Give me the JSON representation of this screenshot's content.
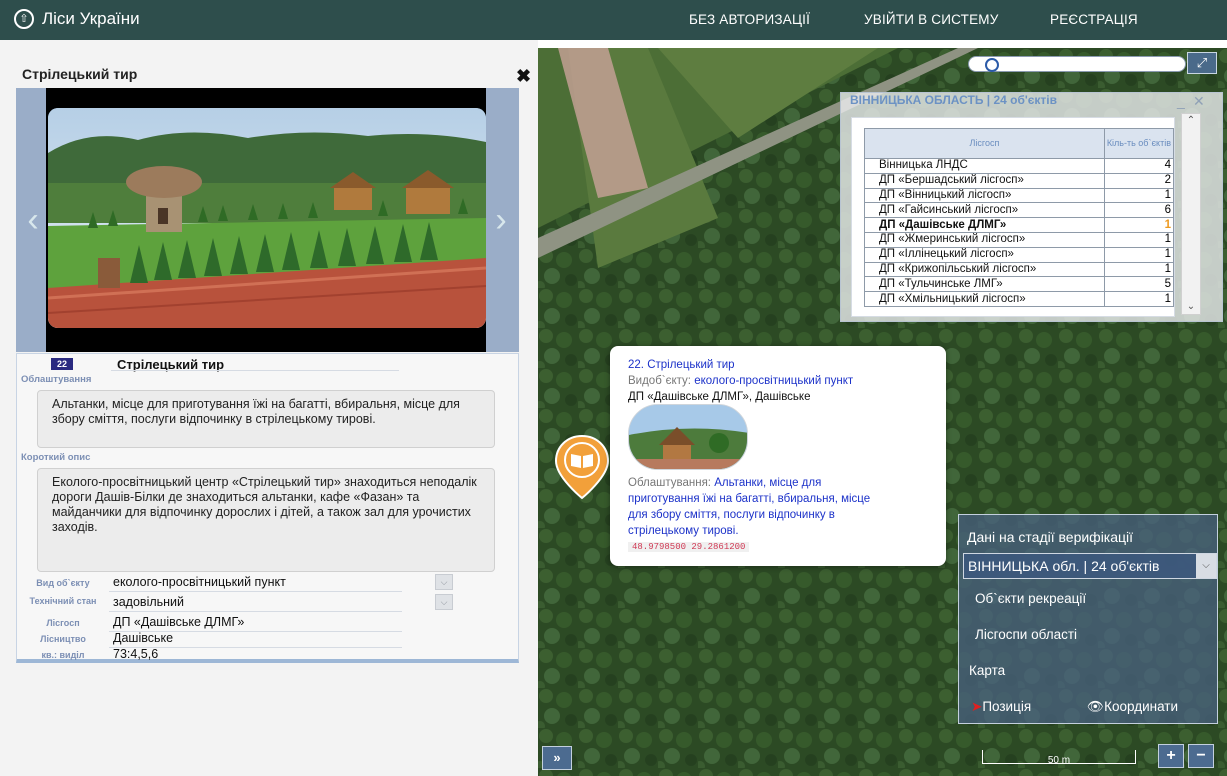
{
  "header": {
    "brand": "Ліси України",
    "nav": [
      "БЕЗ АВТОРИЗАЦІЇ",
      "УВІЙТИ В СИСТЕМУ",
      "РЕЄСТРАЦІЯ"
    ]
  },
  "panel": {
    "title": "Стрілецький тир",
    "close": "✖",
    "item_number": "22",
    "item_title": "Стрілецький тир",
    "facilities_label": "Облаштування",
    "facilities_text": "Альтанки, місце для приготування їжі на багатті, вбиральня, місце для збору сміття, послуги відпочинку в стрілецькому тирові.",
    "description_label": "Короткий опис",
    "description_text": "Еколого-просвітницький центр «Стрілецький тир» знаходиться неподалік дороги Дашів-Білки де знаходиться альтанки, кафе «Фазан» та майданчики для відпочинку дорослих і дітей, а також зал для урочистих заходів.",
    "fields": [
      {
        "label": "Вид об`єкту",
        "value": "еколого-просвітницький пункт"
      },
      {
        "label": "Технічний стан",
        "value": "задовільний"
      },
      {
        "label": "Лісгосп",
        "value": "ДП «Дашівське ДЛМГ»"
      },
      {
        "label": "Лісництво",
        "value": "Дашівське"
      },
      {
        "label": "кв.: виділ",
        "value": "73:4,5,6"
      }
    ]
  },
  "region_window": {
    "title": "ВІННИЦЬКА ОБЛАСТЬ | 24 об'єктів",
    "col_name": "Лісгосп",
    "col_count": "Кіль-ть об`єктів",
    "rows": [
      {
        "name": "Вінницька ЛНДС",
        "count": "4"
      },
      {
        "name": "ДП «Бершадський лісгосп»",
        "count": "2"
      },
      {
        "name": "ДП «Вінницький лісгосп»",
        "count": "1"
      },
      {
        "name": "ДП «Гайсинський лісгосп»",
        "count": "6"
      },
      {
        "name": "ДП «Дашівське ДЛМГ»",
        "count": "1"
      },
      {
        "name": "ДП «Жмеринський лісгосп»",
        "count": "1"
      },
      {
        "name": "ДП «Іллінецький лісгосп»",
        "count": "1"
      },
      {
        "name": "ДП «Крижопільський лісгосп»",
        "count": "1"
      },
      {
        "name": "ДП «Тульчинське ЛМГ»",
        "count": "5"
      },
      {
        "name": "ДП «Хмільницький лісгосп»",
        "count": "1"
      }
    ]
  },
  "popup": {
    "title_prefix": "22.",
    "title": "Стрілецький тир",
    "type_label": "Видоб`єкту:",
    "type_value": "еколого-просвітницький пункт",
    "owner": "ДП «Дашівське ДЛМГ», Дашівське",
    "facilities_label": "Облаштування:",
    "facilities_line1": "Альтанки, місце для",
    "facilities_line2": "приготування їжі на багатті, вбиральня, місце",
    "facilities_line3": "для збору сміття, послуги відпочинку в",
    "facilities_line4": "стрілецькому тирові.",
    "coords": "48.9798500 29.2861200"
  },
  "map_menu": {
    "status": "Дані на стадії верифікації",
    "region_select": "ВІННИЦЬКА обл. | 24 об'єктів",
    "items": [
      "Об`єкти рекреації",
      "Лісгоспи області",
      "Карта"
    ],
    "position": "Позиція",
    "coordinates": "Координати"
  },
  "map_controls": {
    "scale": "50 m",
    "zoom_in": "+",
    "zoom_out": "−",
    "expand_panel": "»"
  }
}
